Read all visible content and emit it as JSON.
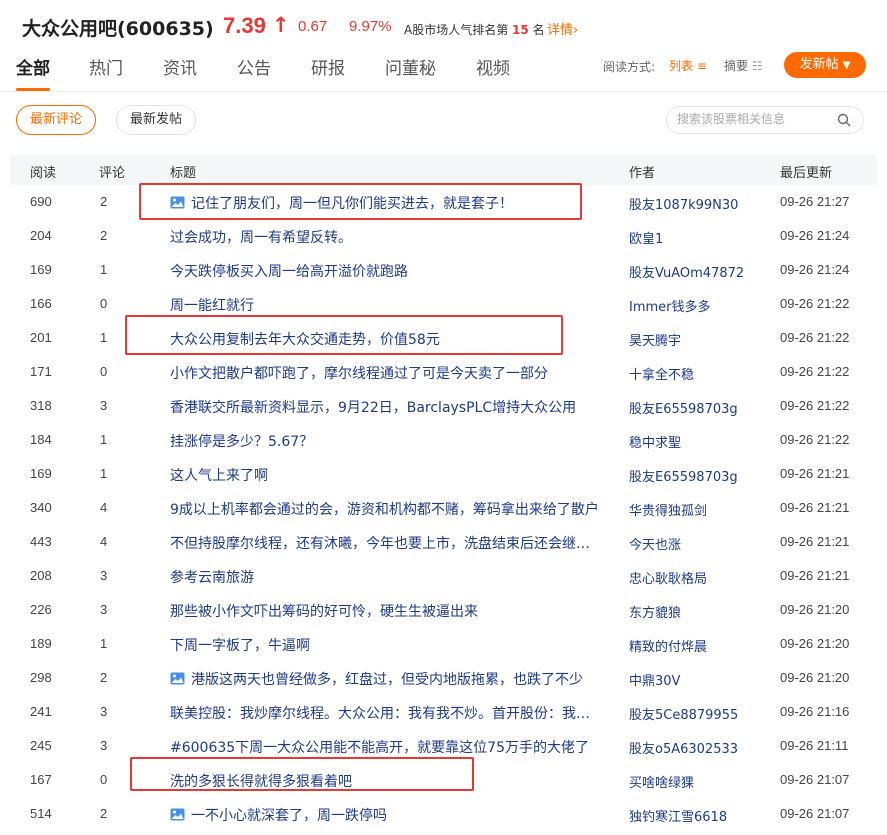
{
  "header": {
    "stock_name": "大众公用吧(600635)",
    "price": "7.39",
    "arrow": "↑",
    "change": "0.67",
    "change_pct": "9.97%",
    "rank_prefix": "A股市场人气排名第",
    "rank_num": "15",
    "rank_suffix": "名",
    "detail": "详情",
    "up_color": "#e53935"
  },
  "tabs": [
    "全部",
    "热门",
    "资讯",
    "公告",
    "研报",
    "问董秘",
    "视频"
  ],
  "read_mode": {
    "label": "阅读方式:",
    "list": "列表",
    "summary": "摘要"
  },
  "post_button": "发新帖",
  "filters": {
    "latest_comment": "最新评论",
    "latest_post": "最新发帖"
  },
  "search": {
    "placeholder": "搜索该股票相关信息"
  },
  "columns": {
    "read": "阅读",
    "comment": "评论",
    "title": "标题",
    "author": "作者",
    "updated": "最后更新"
  },
  "posts": [
    {
      "read": "690",
      "comment": "2",
      "title": "记住了朋友们，周一但凡你们能买进去，就是套子！",
      "author": "股友1087k99N30",
      "time": "09-26 21:27",
      "has_image": true
    },
    {
      "read": "204",
      "comment": "2",
      "title": "过会成功，周一有希望反转。",
      "author": "欧皇1",
      "time": "09-26 21:24",
      "has_image": false
    },
    {
      "read": "169",
      "comment": "1",
      "title": "今天跌停板买入周一给高开溢价就跑路",
      "author": "股友VuAOm47872",
      "time": "09-26 21:24",
      "has_image": false
    },
    {
      "read": "166",
      "comment": "0",
      "title": "周一能红就行",
      "author": "Immer钱多多",
      "time": "09-26 21:22",
      "has_image": false
    },
    {
      "read": "201",
      "comment": "1",
      "title": "大众公用复制去年大众交通走势，价值58元",
      "author": "昊天腾宇",
      "time": "09-26 21:22",
      "has_image": false
    },
    {
      "read": "171",
      "comment": "0",
      "title": "小作文把散户都吓跑了，摩尔线程通过了可是今天卖了一部分",
      "author": "十拿全不稳",
      "time": "09-26 21:22",
      "has_image": false
    },
    {
      "read": "318",
      "comment": "3",
      "title": "香港联交所最新资料显示，9月22日，BarclaysPLC增持大众公用",
      "author": "股友E65598703g",
      "time": "09-26 21:22",
      "has_image": false
    },
    {
      "read": "184",
      "comment": "1",
      "title": "挂涨停是多少？5.67？",
      "author": "稳中求聖",
      "time": "09-26 21:22",
      "has_image": false
    },
    {
      "read": "169",
      "comment": "1",
      "title": "这人气上来了啊",
      "author": "股友E65598703g",
      "time": "09-26 21:21",
      "has_image": false
    },
    {
      "read": "340",
      "comment": "4",
      "title": "9成以上机率都会通过的会，游资和机构都不赌，筹码拿出来给了散户",
      "author": "华贵得独孤剑",
      "time": "09-26 21:21",
      "has_image": false
    },
    {
      "read": "443",
      "comment": "4",
      "title": "不但持股摩尔线程，还有沐曦，今年也要上市，洗盘结束后还会继续涨",
      "author": "今天也涨",
      "time": "09-26 21:21",
      "has_image": false
    },
    {
      "read": "208",
      "comment": "3",
      "title": "参考云南旅游",
      "author": "忠心耿耿格局",
      "time": "09-26 21:21",
      "has_image": false
    },
    {
      "read": "226",
      "comment": "3",
      "title": "那些被小作文吓出筹码的好可怜，硬生生被逼出来",
      "author": "东方貔狼",
      "time": "09-26 21:20",
      "has_image": false
    },
    {
      "read": "189",
      "comment": "1",
      "title": "下周一字板了，牛逼啊",
      "author": "精致的付烨晨",
      "time": "09-26 21:20",
      "has_image": false
    },
    {
      "read": "298",
      "comment": "2",
      "title": "港版这两天也曾经做多，红盘过，但受内地版拖累，也跌了不少",
      "author": "中鼎30V",
      "time": "09-26 21:20",
      "has_image": true
    },
    {
      "read": "241",
      "comment": "3",
      "title": "联美控股：我炒摩尔线程。大众公用：我有我不炒。首开股份：我不炒",
      "author": "股友5Ce8879955",
      "time": "09-26 21:16",
      "has_image": false
    },
    {
      "read": "245",
      "comment": "3",
      "title": "#600635下周一大众公用能不能高开，就要靠这位75万手的大佬了",
      "author": "股友o5A6302533",
      "time": "09-26 21:11",
      "has_image": false
    },
    {
      "read": "167",
      "comment": "0",
      "title": "洗的多狠长得就得多狠看着吧",
      "author": "买啥啥绿猓",
      "time": "09-26 21:07",
      "has_image": false
    },
    {
      "read": "514",
      "comment": "2",
      "title": "一不小心就深套了，周一跌停吗",
      "author": "独钓寒江雪6618",
      "time": "09-26 21:07",
      "has_image": true
    }
  ],
  "highlight_color": "#e53935"
}
